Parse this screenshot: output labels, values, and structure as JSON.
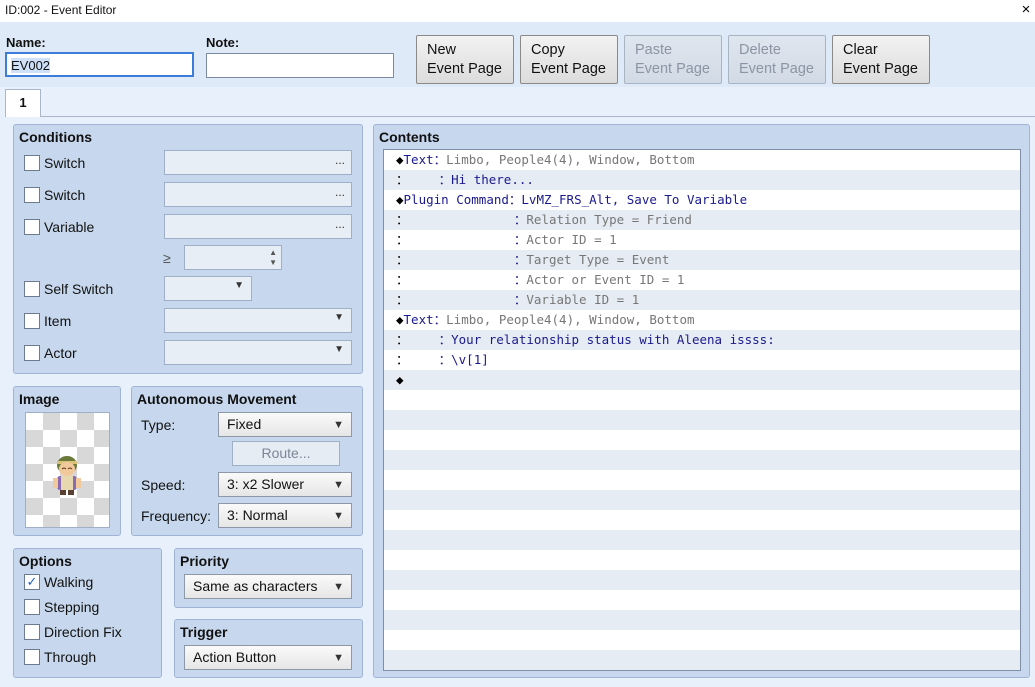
{
  "window": {
    "title": "ID:002 - Event Editor",
    "close": "×"
  },
  "name_field": {
    "label": "Name:",
    "value": "EV002"
  },
  "note_field": {
    "label": "Note:",
    "value": ""
  },
  "buttons": {
    "new": [
      "New",
      "Event Page"
    ],
    "copy": [
      "Copy",
      "Event Page"
    ],
    "paste": [
      "Paste",
      "Event Page"
    ],
    "delete": [
      "Delete",
      "Event Page"
    ],
    "clear": [
      "Clear",
      "Event Page"
    ]
  },
  "tab": {
    "label": "1"
  },
  "conditions": {
    "title": "Conditions",
    "switch1": "Switch",
    "switch2": "Switch",
    "variable": "Variable",
    "gte": "≥",
    "self_switch": "Self Switch",
    "item": "Item",
    "actor": "Actor",
    "dots": "..."
  },
  "image": {
    "title": "Image"
  },
  "movement": {
    "title": "Autonomous Movement",
    "type_label": "Type:",
    "type_value": "Fixed",
    "route_label": "Route...",
    "speed_label": "Speed:",
    "speed_value": "3: x2 Slower",
    "freq_label": "Frequency:",
    "freq_value": "3: Normal"
  },
  "options": {
    "title": "Options",
    "walking": "Walking",
    "walking_checked": "✓",
    "stepping": "Stepping",
    "direction_fix": "Direction Fix",
    "through": "Through"
  },
  "priority": {
    "title": "Priority",
    "value": "Same as characters"
  },
  "trigger": {
    "title": "Trigger",
    "value": "Action Button"
  },
  "contents": {
    "title": "Contents",
    "lines": [
      [
        "◆",
        "Text",
        "：",
        "Limbo, People4(4), Window, Bottom"
      ],
      [
        "：",
        "    ：",
        "Hi there..."
      ],
      [
        "◆",
        "Plugin Command",
        "：",
        "LvMZ_FRS_Alt, Save To Variable"
      ],
      [
        "：",
        "              ：",
        "Relation Type = Friend"
      ],
      [
        "：",
        "              ：",
        "Actor ID = 1"
      ],
      [
        "：",
        "              ：",
        "Target Type = Event"
      ],
      [
        "：",
        "              ：",
        "Actor or Event ID = 1"
      ],
      [
        "：",
        "              ：",
        "Variable ID = 1"
      ],
      [
        "◆",
        "Text",
        "：",
        "Limbo, People4(4), Window, Bottom"
      ],
      [
        "：",
        "    ：",
        "Your relationship status with Aleena issss:"
      ],
      [
        "：",
        "    ：",
        "\\v[1]"
      ],
      [
        "◆"
      ]
    ]
  }
}
